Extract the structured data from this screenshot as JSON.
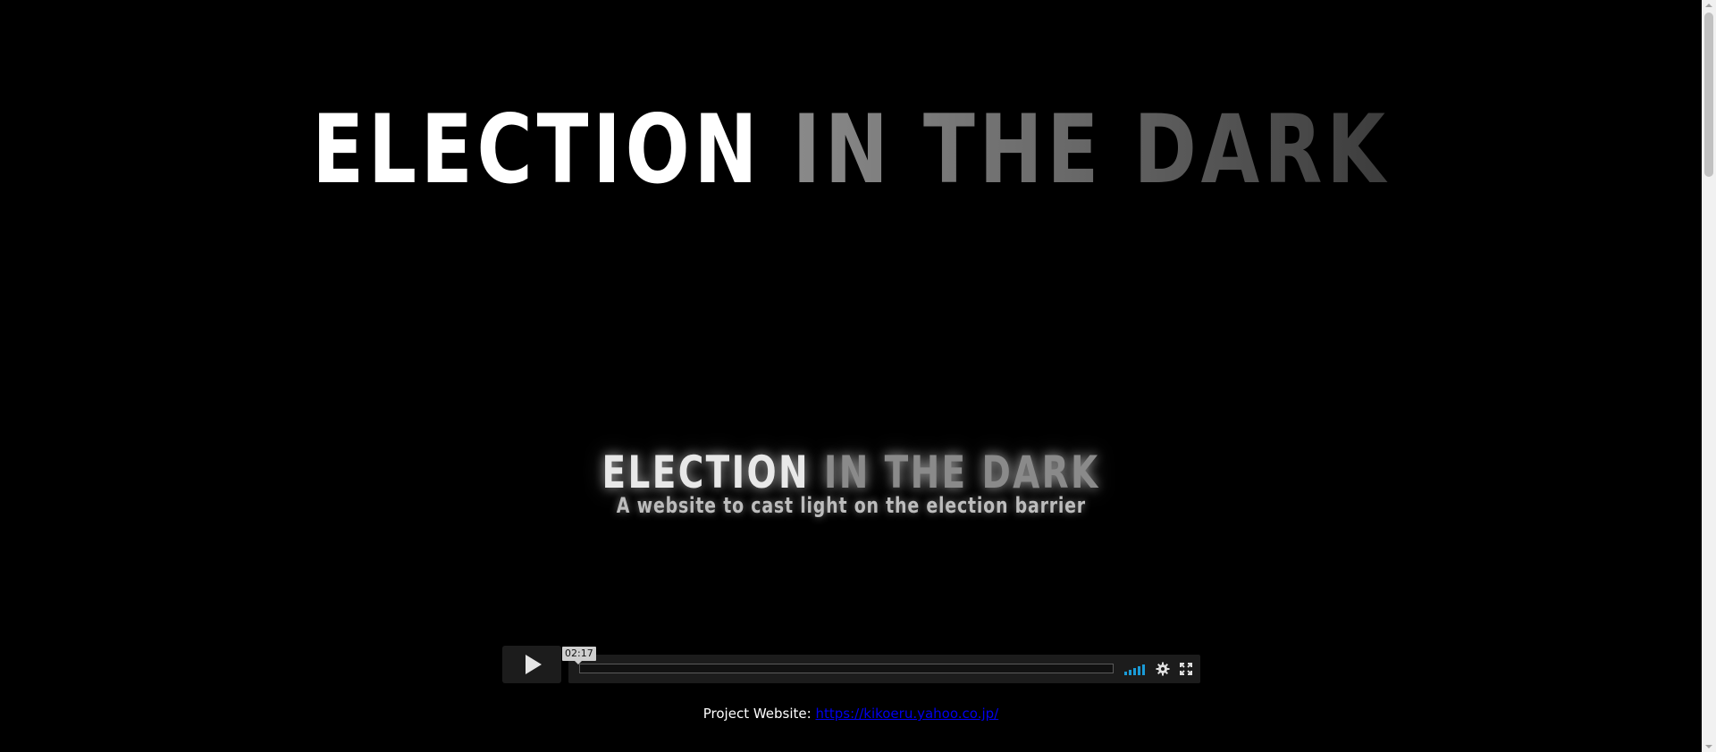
{
  "hero": {
    "title_word1": "ELECTION",
    "title_word2": "IN THE DARK"
  },
  "video": {
    "title_word1": "ELECTION",
    "title_word2": "IN THE DARK",
    "subtitle": "A website to cast light on the election barrier",
    "duration_tooltip": "02:17",
    "progress": 0,
    "volume_bars": 5,
    "accent_color": "#1a9bd7",
    "icons": {
      "play": "play-icon",
      "volume": "volume-icon",
      "settings": "gear-icon",
      "fullscreen": "fullscreen-icon"
    }
  },
  "project": {
    "label": "Project Website:",
    "link_text": "https://kikoeru.yahoo.co.jp/"
  }
}
